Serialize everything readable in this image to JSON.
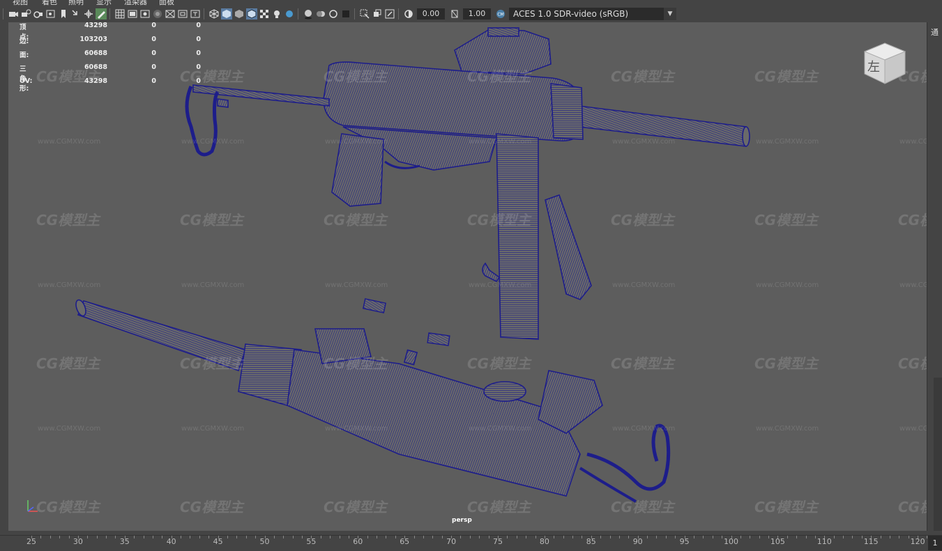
{
  "menu": {
    "items": [
      "视图",
      "着色",
      "照明",
      "显示",
      "渲染器",
      "面板"
    ]
  },
  "toolbar": {
    "exposure_value": "0.00",
    "gamma_value": "1.00",
    "color_space": "ACES 1.0 SDR-video (sRGB)",
    "icons": [
      "camera-select-icon",
      "camera-attributes-icon",
      "bookmark-icon",
      "image-plane-icon",
      "grease-pencil-icon",
      "grid-icon",
      "film-gate-icon",
      "resolution-gate-icon",
      "gate-mask-icon",
      "field-chart-icon",
      "safe-action-icon",
      "safe-title-icon",
      "wireframe-icon",
      "smooth-shade-icon",
      "default-material-icon",
      "wireframe-on-shaded-icon",
      "textured-icon",
      "lights-icon",
      "shadows-icon",
      "ambient-occlusion-icon",
      "motion-blur-icon",
      "anti-aliasing-icon",
      "depth-of-field-icon",
      "isolate-select-icon",
      "xray-icon",
      "xray-active-icon",
      "xray-joints-icon",
      "exposure-icon",
      "gamma-icon",
      "color-management-icon"
    ]
  },
  "hud": {
    "rows": [
      {
        "label": "顶点:",
        "v1": "43298",
        "v2": "0",
        "v3": "0"
      },
      {
        "label": "边:",
        "v1": "103203",
        "v2": "0",
        "v3": "0"
      },
      {
        "label": "面:",
        "v1": "60688",
        "v2": "0",
        "v3": "0"
      },
      {
        "label": "三角形:",
        "v1": "60688",
        "v2": "0",
        "v3": "0"
      },
      {
        "label": "UV:",
        "v1": "43298",
        "v2": "0",
        "v3": "0"
      }
    ]
  },
  "viewport": {
    "camera_label": "persp",
    "viewcube_face": "左",
    "watermark_logo": "CG模型主",
    "watermark_url": "www.CGMXW.com",
    "wire_color": "#1d1d8a",
    "background_color": "#5d5d5d"
  },
  "right_panel": {
    "label": "通"
  },
  "timeline": {
    "ticks": [
      "25",
      "30",
      "35",
      "40",
      "45",
      "50",
      "55",
      "60",
      "65",
      "70",
      "75",
      "80",
      "85",
      "90",
      "95",
      "100",
      "105",
      "110",
      "115",
      "120"
    ],
    "current_frame": "1"
  }
}
